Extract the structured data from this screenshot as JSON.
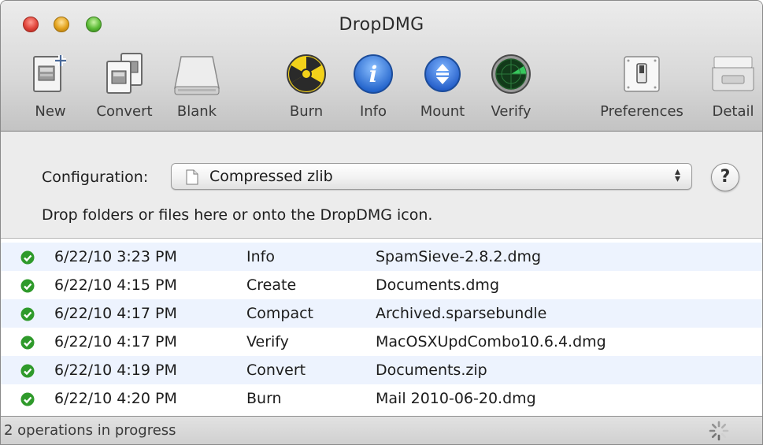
{
  "window": {
    "title": "DropDMG"
  },
  "toolbar": {
    "items": [
      {
        "label": "New",
        "icon": "new-disk-icon"
      },
      {
        "label": "Convert",
        "icon": "convert-icon"
      },
      {
        "label": "Blank",
        "icon": "blank-drive-icon"
      },
      {
        "label": "Burn",
        "icon": "radiation-burn-icon"
      },
      {
        "label": "Info",
        "icon": "info-icon"
      },
      {
        "label": "Mount",
        "icon": "mount-icon"
      },
      {
        "label": "Verify",
        "icon": "radar-verify-icon"
      },
      {
        "label": "Preferences",
        "icon": "switch-preferences-icon"
      },
      {
        "label": "Detail",
        "icon": "detail-tray-icon"
      }
    ]
  },
  "config": {
    "label": "Configuration:",
    "selected": "Compressed zlib",
    "help_label": "?",
    "hint": "Drop folders or files here or onto the DropDMG icon."
  },
  "log": {
    "rows": [
      {
        "date": "6/22/10 3:23 PM",
        "action": "Info",
        "file": "SpamSieve-2.8.2.dmg"
      },
      {
        "date": "6/22/10 4:15 PM",
        "action": "Create",
        "file": "Documents.dmg"
      },
      {
        "date": "6/22/10 4:17 PM",
        "action": "Compact",
        "file": "Archived.sparsebundle"
      },
      {
        "date": "6/22/10 4:17 PM",
        "action": "Verify",
        "file": "MacOSXUpdCombo10.6.4.dmg"
      },
      {
        "date": "6/22/10 4:19 PM",
        "action": "Convert",
        "file": "Documents.zip"
      },
      {
        "date": "6/22/10 4:20 PM",
        "action": "Burn",
        "file": "Mail 2010-06-20.dmg"
      }
    ]
  },
  "status": {
    "text": "2 operations in progress"
  },
  "colors": {
    "row_alt": "#edf3fe",
    "check_green": "#2f9a2b",
    "info_blue": "#2a6fd8"
  }
}
